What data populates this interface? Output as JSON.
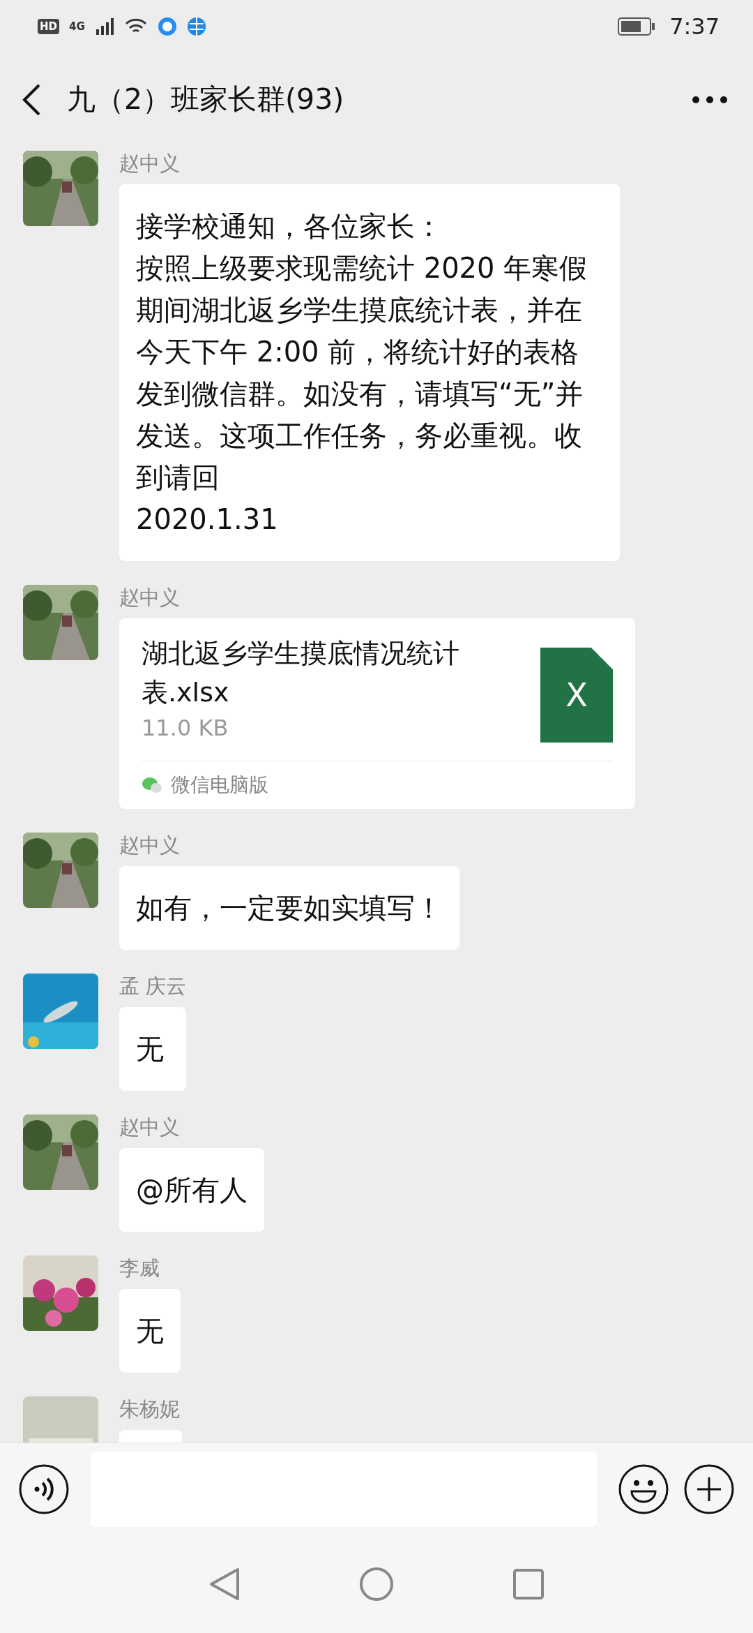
{
  "status_bar": {
    "network": [
      "HD",
      "4G"
    ],
    "time": "7:37"
  },
  "header": {
    "title": "九（2）班家长群(93)"
  },
  "messages": [
    {
      "sender": "赵中义",
      "kind": "text",
      "paragraphs": [
        "接学校通知，各位家长：",
        "按照上级要求现需统计 2020 年寒假期间湖北返乡学生摸底统计表，并在今天下午 2:00 前，将统计好的表格发到微信群。如没有，请填写“无”并发送。这项工作任务，务必重视。收到请回",
        "2020.1.31"
      ]
    },
    {
      "sender": "赵中义",
      "kind": "file",
      "file_name": "湖北返乡学生摸底情况统计表.xlsx",
      "file_size": "11.0 KB",
      "file_badge": "X",
      "source": "微信电脑版"
    },
    {
      "sender": "赵中义",
      "kind": "text",
      "paragraphs": [
        "如有，一定要如实填写！"
      ]
    },
    {
      "sender": "孟 庆云",
      "kind": "text",
      "paragraphs": [
        "无"
      ]
    },
    {
      "sender": "赵中义",
      "kind": "text",
      "paragraphs": [
        "@所有人"
      ]
    },
    {
      "sender": "李威",
      "kind": "text",
      "paragraphs": [
        "无"
      ]
    },
    {
      "sender": "朱杨妮",
      "kind": "cut"
    }
  ]
}
